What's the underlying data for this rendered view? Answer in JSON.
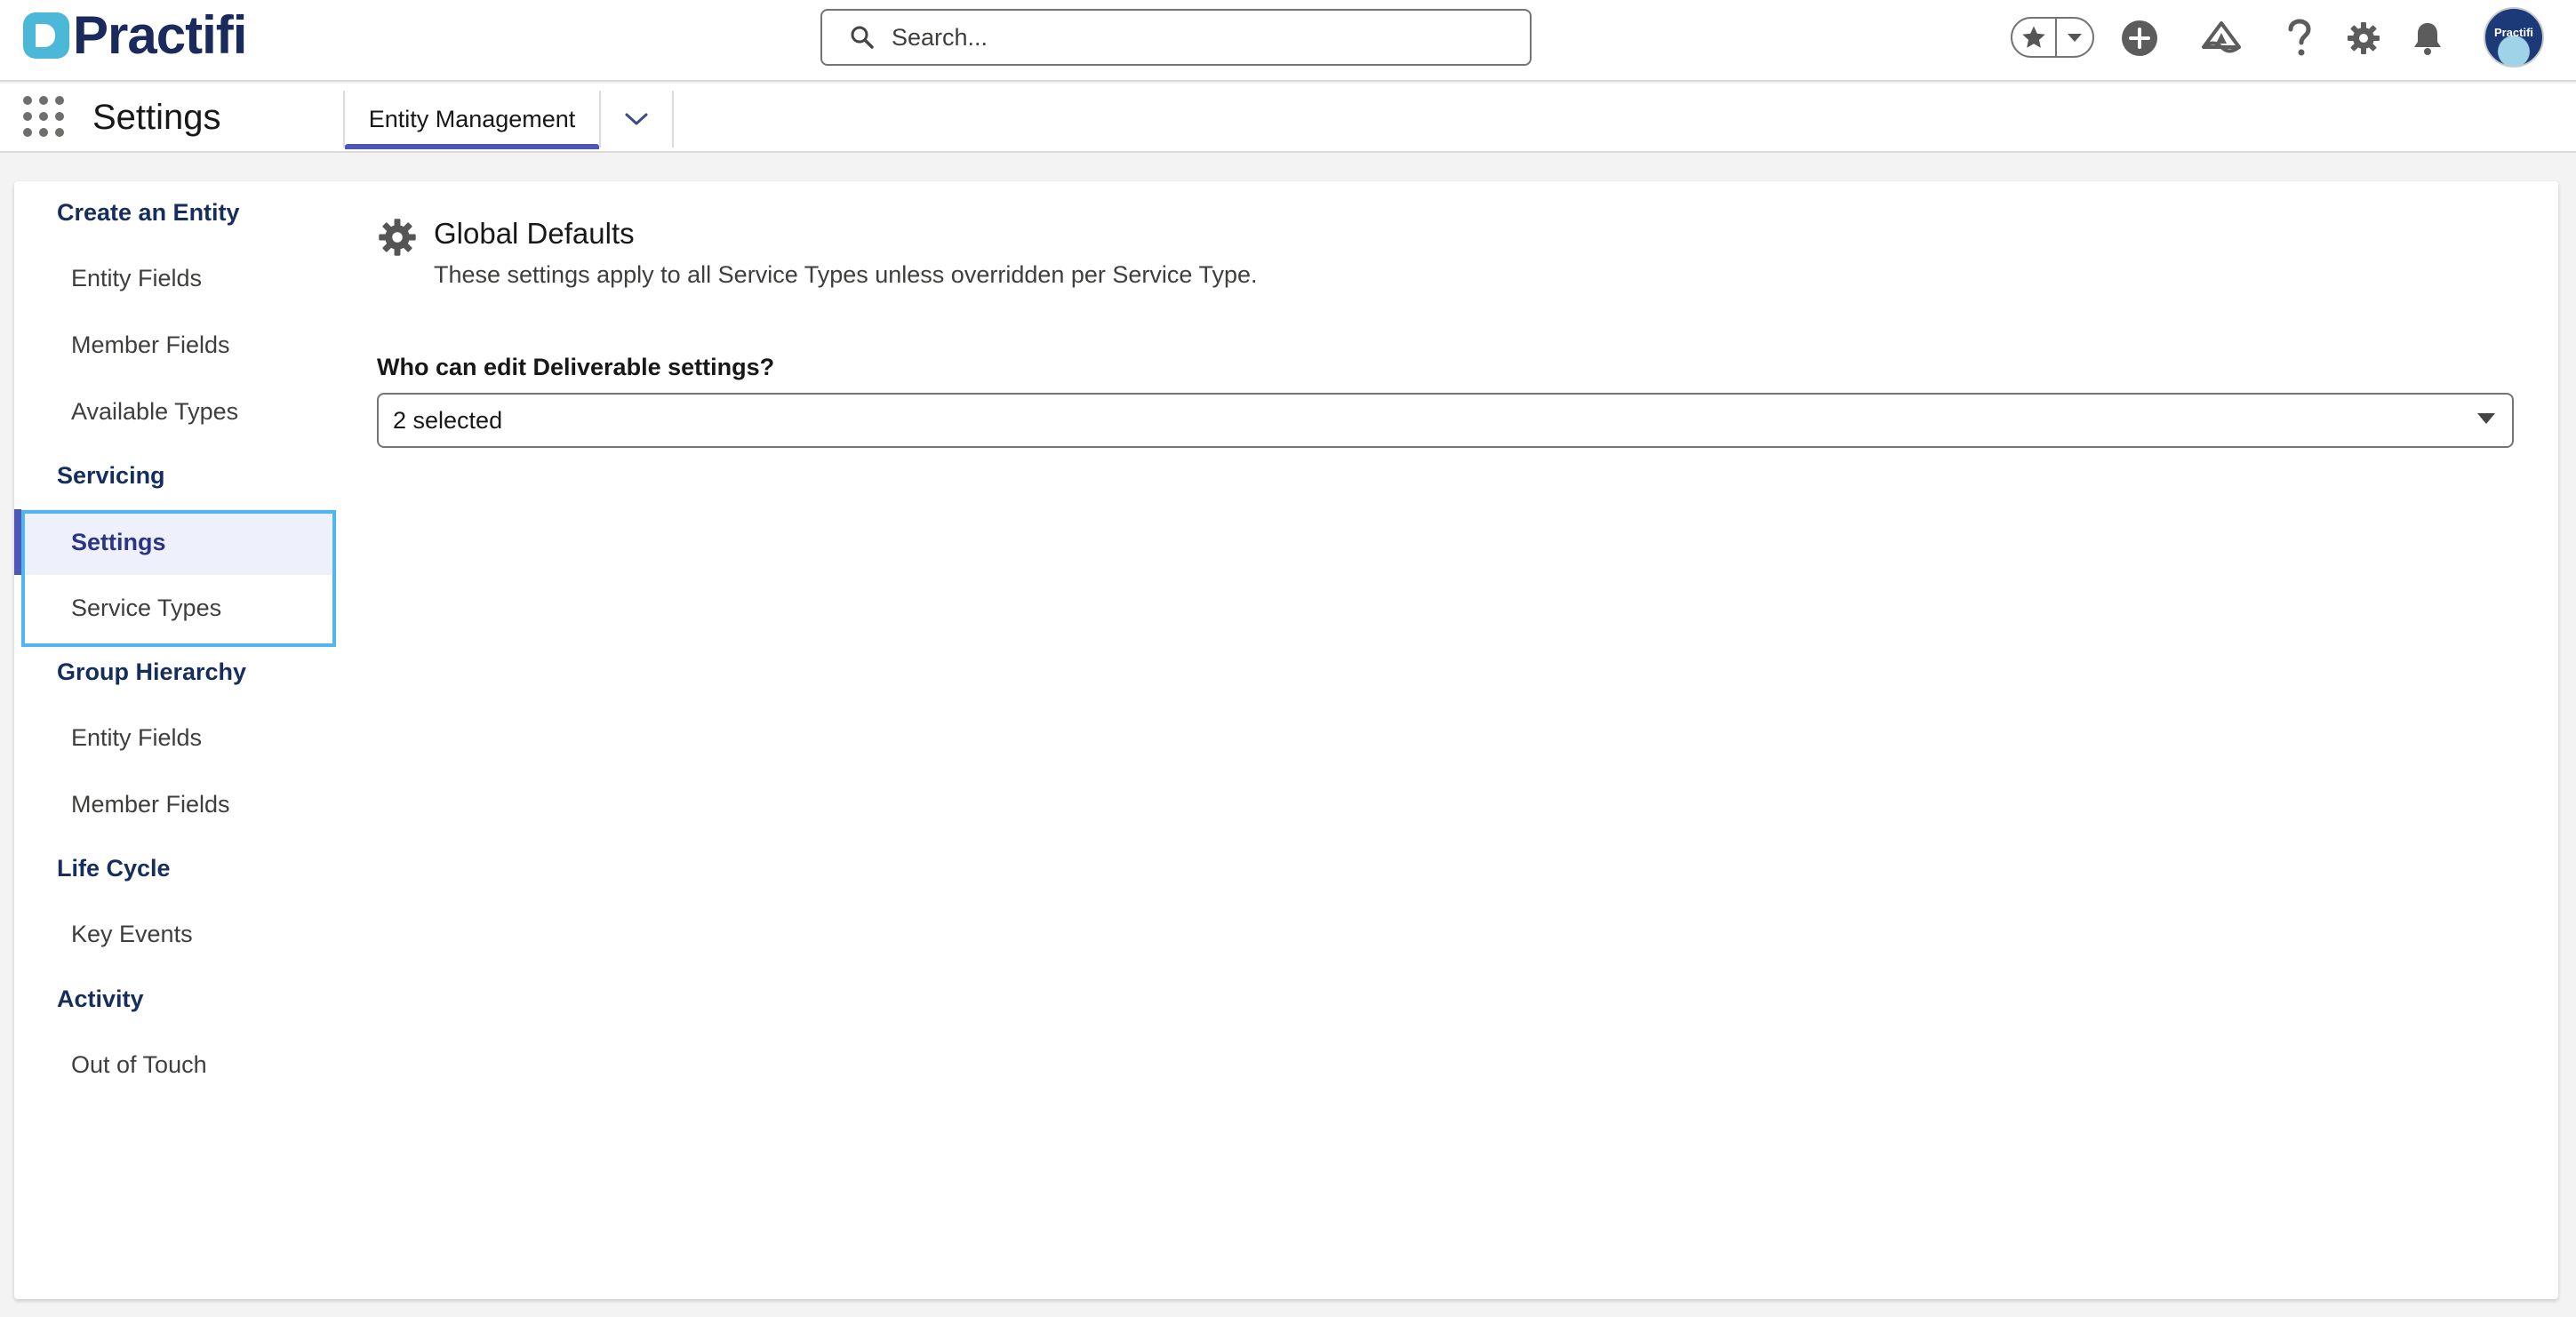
{
  "header": {
    "logo_text": "Practifi",
    "search_placeholder": "Search...",
    "avatar_text": "Practifi",
    "icons": [
      "favorites-star-icon",
      "add-icon",
      "trailhead-icon",
      "help-icon",
      "setup-gear-icon",
      "notifications-bell-icon"
    ]
  },
  "nav": {
    "app_name": "Settings",
    "tabs": [
      {
        "label": "Entity Management",
        "active": true
      }
    ]
  },
  "sidebar": {
    "sections": [
      {
        "title": "Create an Entity",
        "items": [
          "Entity Fields",
          "Member Fields",
          "Available Types"
        ]
      },
      {
        "title": "Servicing",
        "items": [
          "Settings",
          "Service Types"
        ]
      },
      {
        "title": "Group Hierarchy",
        "items": [
          "Entity Fields",
          "Member Fields"
        ]
      },
      {
        "title": "Life Cycle",
        "items": [
          "Key Events"
        ]
      },
      {
        "title": "Activity",
        "items": [
          "Out of Touch"
        ]
      }
    ],
    "active_item": "Settings"
  },
  "main": {
    "title": "Global Defaults",
    "description": "These settings apply to all Service Types unless overridden per Service Type.",
    "field_label": "Who can edit Deliverable settings?",
    "select_value": "2 selected"
  },
  "colors": {
    "brand_navy": "#1b2a5c",
    "brand_teal": "#4ab8d6",
    "active_accent": "#4c57b6",
    "highlight_border": "#4fb6ef"
  }
}
